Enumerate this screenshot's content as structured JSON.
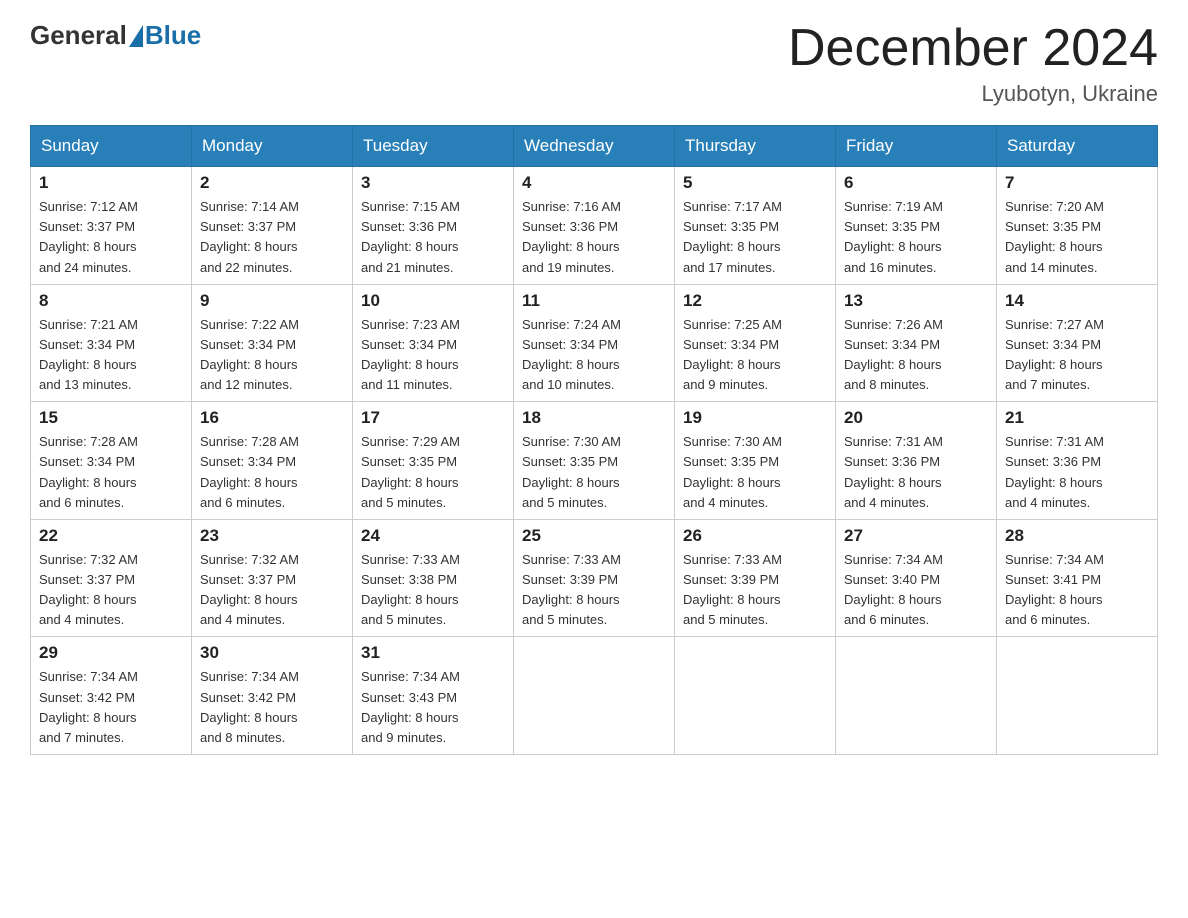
{
  "header": {
    "logo_general": "General",
    "logo_blue": "Blue",
    "month_title": "December 2024",
    "location": "Lyubotyn, Ukraine"
  },
  "weekdays": [
    "Sunday",
    "Monday",
    "Tuesday",
    "Wednesday",
    "Thursday",
    "Friday",
    "Saturday"
  ],
  "weeks": [
    [
      {
        "day": "1",
        "sunrise": "7:12 AM",
        "sunset": "3:37 PM",
        "daylight": "8 hours and 24 minutes."
      },
      {
        "day": "2",
        "sunrise": "7:14 AM",
        "sunset": "3:37 PM",
        "daylight": "8 hours and 22 minutes."
      },
      {
        "day": "3",
        "sunrise": "7:15 AM",
        "sunset": "3:36 PM",
        "daylight": "8 hours and 21 minutes."
      },
      {
        "day": "4",
        "sunrise": "7:16 AM",
        "sunset": "3:36 PM",
        "daylight": "8 hours and 19 minutes."
      },
      {
        "day": "5",
        "sunrise": "7:17 AM",
        "sunset": "3:35 PM",
        "daylight": "8 hours and 17 minutes."
      },
      {
        "day": "6",
        "sunrise": "7:19 AM",
        "sunset": "3:35 PM",
        "daylight": "8 hours and 16 minutes."
      },
      {
        "day": "7",
        "sunrise": "7:20 AM",
        "sunset": "3:35 PM",
        "daylight": "8 hours and 14 minutes."
      }
    ],
    [
      {
        "day": "8",
        "sunrise": "7:21 AM",
        "sunset": "3:34 PM",
        "daylight": "8 hours and 13 minutes."
      },
      {
        "day": "9",
        "sunrise": "7:22 AM",
        "sunset": "3:34 PM",
        "daylight": "8 hours and 12 minutes."
      },
      {
        "day": "10",
        "sunrise": "7:23 AM",
        "sunset": "3:34 PM",
        "daylight": "8 hours and 11 minutes."
      },
      {
        "day": "11",
        "sunrise": "7:24 AM",
        "sunset": "3:34 PM",
        "daylight": "8 hours and 10 minutes."
      },
      {
        "day": "12",
        "sunrise": "7:25 AM",
        "sunset": "3:34 PM",
        "daylight": "8 hours and 9 minutes."
      },
      {
        "day": "13",
        "sunrise": "7:26 AM",
        "sunset": "3:34 PM",
        "daylight": "8 hours and 8 minutes."
      },
      {
        "day": "14",
        "sunrise": "7:27 AM",
        "sunset": "3:34 PM",
        "daylight": "8 hours and 7 minutes."
      }
    ],
    [
      {
        "day": "15",
        "sunrise": "7:28 AM",
        "sunset": "3:34 PM",
        "daylight": "8 hours and 6 minutes."
      },
      {
        "day": "16",
        "sunrise": "7:28 AM",
        "sunset": "3:34 PM",
        "daylight": "8 hours and 6 minutes."
      },
      {
        "day": "17",
        "sunrise": "7:29 AM",
        "sunset": "3:35 PM",
        "daylight": "8 hours and 5 minutes."
      },
      {
        "day": "18",
        "sunrise": "7:30 AM",
        "sunset": "3:35 PM",
        "daylight": "8 hours and 5 minutes."
      },
      {
        "day": "19",
        "sunrise": "7:30 AM",
        "sunset": "3:35 PM",
        "daylight": "8 hours and 4 minutes."
      },
      {
        "day": "20",
        "sunrise": "7:31 AM",
        "sunset": "3:36 PM",
        "daylight": "8 hours and 4 minutes."
      },
      {
        "day": "21",
        "sunrise": "7:31 AM",
        "sunset": "3:36 PM",
        "daylight": "8 hours and 4 minutes."
      }
    ],
    [
      {
        "day": "22",
        "sunrise": "7:32 AM",
        "sunset": "3:37 PM",
        "daylight": "8 hours and 4 minutes."
      },
      {
        "day": "23",
        "sunrise": "7:32 AM",
        "sunset": "3:37 PM",
        "daylight": "8 hours and 4 minutes."
      },
      {
        "day": "24",
        "sunrise": "7:33 AM",
        "sunset": "3:38 PM",
        "daylight": "8 hours and 5 minutes."
      },
      {
        "day": "25",
        "sunrise": "7:33 AM",
        "sunset": "3:39 PM",
        "daylight": "8 hours and 5 minutes."
      },
      {
        "day": "26",
        "sunrise": "7:33 AM",
        "sunset": "3:39 PM",
        "daylight": "8 hours and 5 minutes."
      },
      {
        "day": "27",
        "sunrise": "7:34 AM",
        "sunset": "3:40 PM",
        "daylight": "8 hours and 6 minutes."
      },
      {
        "day": "28",
        "sunrise": "7:34 AM",
        "sunset": "3:41 PM",
        "daylight": "8 hours and 6 minutes."
      }
    ],
    [
      {
        "day": "29",
        "sunrise": "7:34 AM",
        "sunset": "3:42 PM",
        "daylight": "8 hours and 7 minutes."
      },
      {
        "day": "30",
        "sunrise": "7:34 AM",
        "sunset": "3:42 PM",
        "daylight": "8 hours and 8 minutes."
      },
      {
        "day": "31",
        "sunrise": "7:34 AM",
        "sunset": "3:43 PM",
        "daylight": "8 hours and 9 minutes."
      },
      null,
      null,
      null,
      null
    ]
  ],
  "labels": {
    "sunrise_prefix": "Sunrise: ",
    "sunset_prefix": "Sunset: ",
    "daylight_prefix": "Daylight: "
  }
}
